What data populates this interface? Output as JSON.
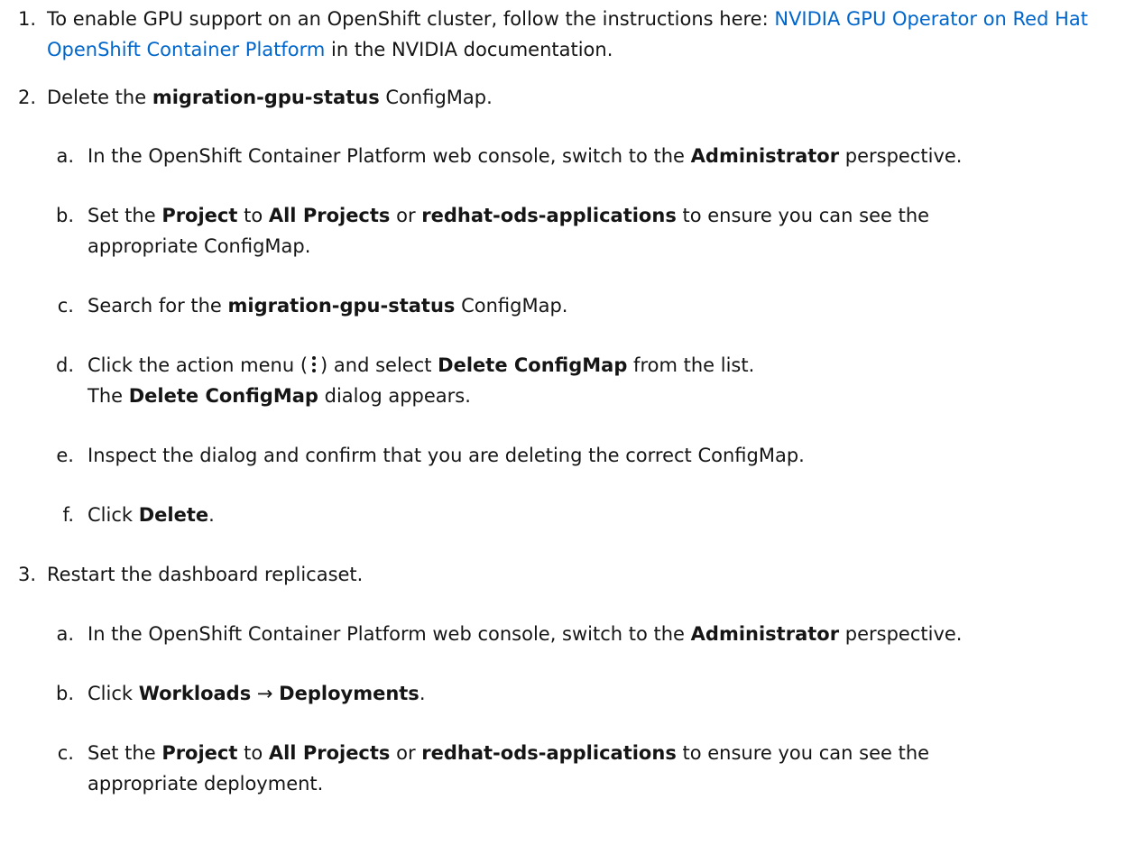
{
  "steps": [
    {
      "num": "1.",
      "text_before": "To enable GPU support on an OpenShift cluster, follow the instructions here: ",
      "link": "NVIDIA GPU Operator on Red Hat OpenShift Container Platform",
      "text_after": " in the NVIDIA documentation."
    },
    {
      "num": "2.",
      "t1": "Delete the ",
      "b1": "migration-gpu-status",
      "t2": " ConfigMap.",
      "substeps": [
        {
          "num": "a.",
          "t1": "In the OpenShift Container Platform web console, switch to the ",
          "b1": "Administrator",
          "t2": " perspective."
        },
        {
          "num": "b.",
          "t1": "Set the ",
          "b1": "Project",
          "t2": " to ",
          "b2": "All Projects",
          "t3": " or ",
          "b3": "redhat-ods-applications",
          "t4": " to ensure you can see the appropriate ConfigMap."
        },
        {
          "num": "c.",
          "t1": "Search for the ",
          "b1": "migration-gpu-status",
          "t2": " ConfigMap."
        },
        {
          "num": "d.",
          "t1": "Click the action menu (",
          "icon": "kebab-icon",
          "t2": ") and select ",
          "b1": "Delete ConfigMap",
          "t3": " from the list.",
          "t4": "The ",
          "b2": "Delete ConfigMap",
          "t5": " dialog appears."
        },
        {
          "num": "e.",
          "t1": "Inspect the dialog and confirm that you are deleting the correct ConfigMap."
        },
        {
          "num": "f.",
          "t1": "Click ",
          "b1": "Delete",
          "t2": "."
        }
      ]
    },
    {
      "num": "3.",
      "t1": "Restart the dashboard replicaset.",
      "substeps": [
        {
          "num": "a.",
          "t1": "In the OpenShift Container Platform web console, switch to the ",
          "b1": "Administrator",
          "t2": " perspective."
        },
        {
          "num": "b.",
          "t1": "Click ",
          "b1": "Workloads",
          "t2": " → ",
          "b2": "Deployments",
          "t3": "."
        },
        {
          "num": "c.",
          "t1": "Set the ",
          "b1": "Project",
          "t2": " to ",
          "b2": "All Projects",
          "t3": " or ",
          "b3": "redhat-ods-applications",
          "t4": " to ensure you can see the appropriate deployment."
        }
      ]
    }
  ]
}
